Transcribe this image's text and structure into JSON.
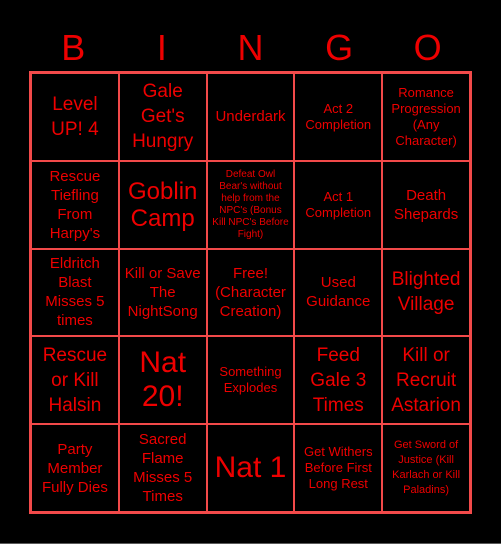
{
  "card": {
    "header_letters": [
      "B",
      "I",
      "N",
      "G",
      "O"
    ],
    "text_color": "#ee0000",
    "line_color": "#f24a4a",
    "background_color": "#000000",
    "cells": [
      [
        "Level UP! 4",
        "Gale Get's Hungry",
        "Underdark",
        "Act 2 Completion",
        "Romance Progression (Any Character)"
      ],
      [
        "Rescue Tiefling From Harpy's",
        "Goblin Camp",
        "Defeat Owl Bear's without help from the NPC's (Bonus Kill NPC's Before Fight)",
        "Act 1 Completion",
        "Death Shepards"
      ],
      [
        "Eldritch Blast Misses 5 times",
        "Kill or Save The NightSong",
        "Free! (Character Creation)",
        "Used Guidance",
        "Blighted Village"
      ],
      [
        "Rescue or Kill Halsin",
        "Nat 20!",
        "Something Explodes",
        "Feed Gale 3 Times",
        "Kill or Recruit Astarion"
      ],
      [
        "Party Member Fully Dies",
        "Sacred Flame Misses 5 Times",
        "Nat 1",
        "Get Withers Before First Long Rest",
        "Get Sword of Justice (Kill Karlach or Kill Paladins)"
      ]
    ]
  }
}
